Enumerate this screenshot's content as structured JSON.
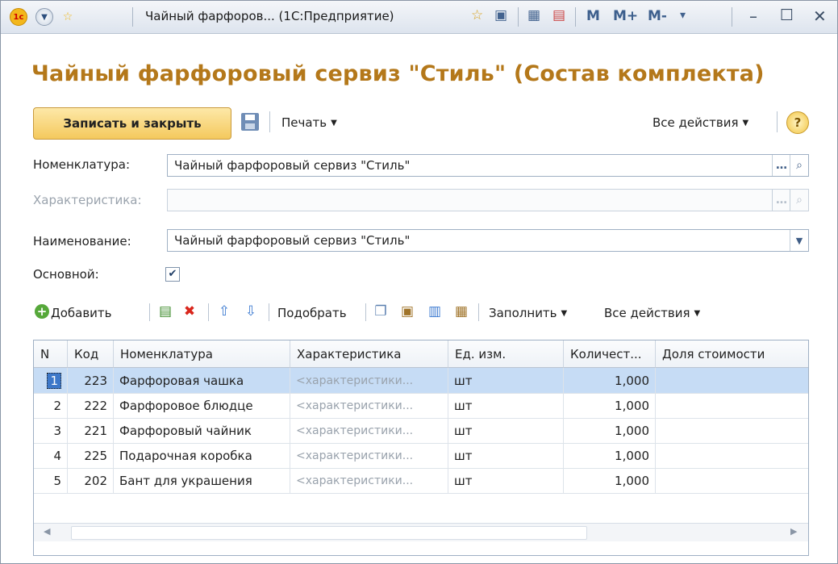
{
  "window": {
    "title": "Чайный фарфоров...  (1С:Предприятие)",
    "mem_buttons": [
      "M",
      "M+",
      "M-"
    ]
  },
  "form": {
    "heading": "Чайный фарфоровый сервиз \"Стиль\" (Состав комплекта)",
    "toolbar": {
      "primary": "Записать и закрыть",
      "print": "Печать",
      "all_actions": "Все действия",
      "help": "?"
    },
    "fields": {
      "nomenclature_label": "Номенклатура:",
      "nomenclature_value": "Чайный фарфоровый сервиз \"Стиль\"",
      "characteristic_label": "Характеристика:",
      "characteristic_value": "",
      "name_label": "Наименование:",
      "name_value": "Чайный фарфоровый сервиз \"Стиль\"",
      "main_label": "Основной:",
      "main_checked": true
    }
  },
  "table_toolbar": {
    "add": "Добавить",
    "pick": "Подобрать",
    "fill": "Заполнить",
    "all_actions": "Все действия"
  },
  "table": {
    "headers": [
      "N",
      "Код",
      "Номенклатура",
      "Характеристика",
      "Ед. изм.",
      "Количест...",
      "Доля стоимости"
    ],
    "rows": [
      {
        "n": "1",
        "code": "223",
        "item": "Фарфоровая чашка",
        "char": "<характеристики...",
        "unit": "шт",
        "qty": "1,000",
        "share": ""
      },
      {
        "n": "2",
        "code": "222",
        "item": "Фарфоровое блюдце",
        "char": "<характеристики...",
        "unit": "шт",
        "qty": "1,000",
        "share": ""
      },
      {
        "n": "3",
        "code": "221",
        "item": "Фарфоровый чайник",
        "char": "<характеристики...",
        "unit": "шт",
        "qty": "1,000",
        "share": ""
      },
      {
        "n": "4",
        "code": "225",
        "item": "Подарочная коробка",
        "char": "<характеристики...",
        "unit": "шт",
        "qty": "1,000",
        "share": ""
      },
      {
        "n": "5",
        "code": "202",
        "item": "Бант для украшения",
        "char": "<характеристики...",
        "unit": "шт",
        "qty": "1,000",
        "share": ""
      }
    ],
    "selected_row": 0
  },
  "colors": {
    "heading": "#b4781a",
    "primary_button": "#f4c95d",
    "selected_row": "#c6dcf5"
  }
}
